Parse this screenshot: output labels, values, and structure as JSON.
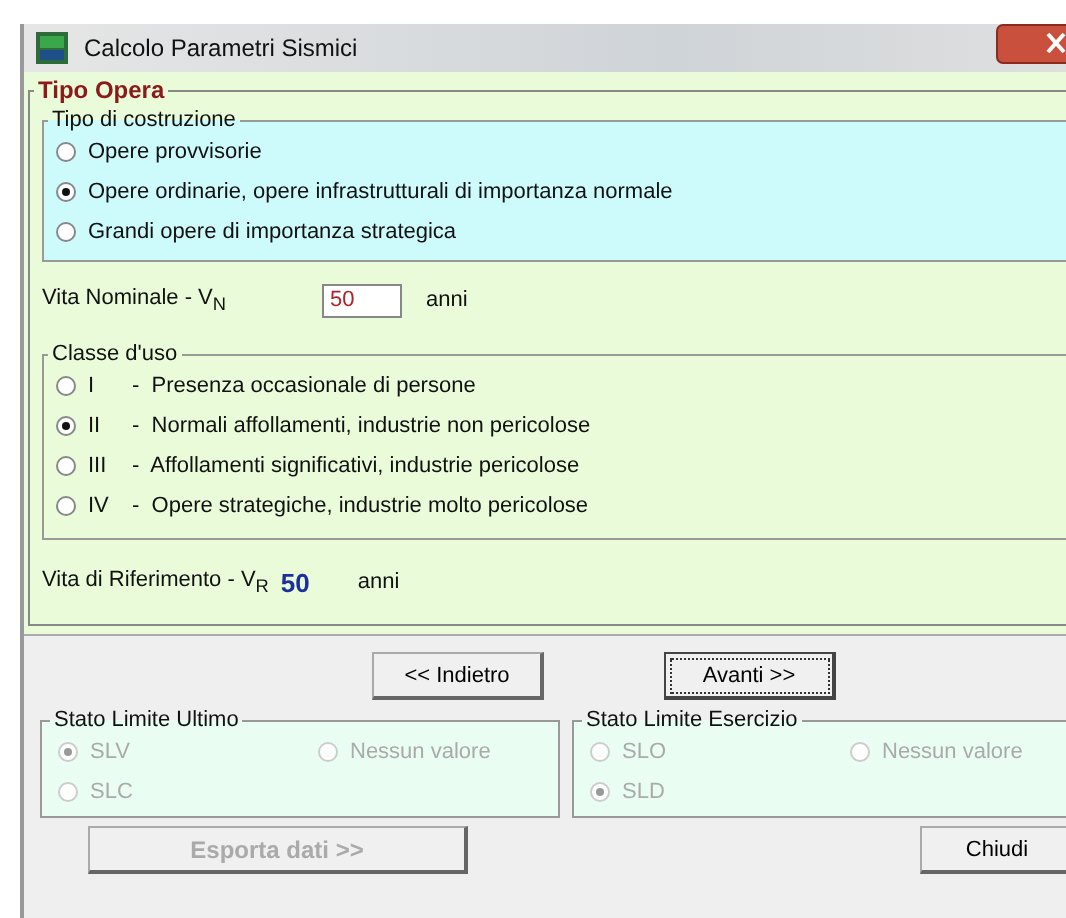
{
  "window": {
    "title": "Calcolo Parametri Sismici"
  },
  "tipo_opera": {
    "title": "Tipo Opera",
    "tipo_costruzione": {
      "title": "Tipo di costruzione",
      "options": [
        {
          "label": "Opere provvisorie",
          "selected": false
        },
        {
          "label": "Opere ordinarie, opere infrastrutturali di importanza normale",
          "selected": true
        },
        {
          "label": "Grandi opere di importanza strategica",
          "selected": false
        }
      ]
    },
    "vita_nominale": {
      "label": "Vita Nominale - V$_{N}$",
      "value": "50",
      "unit": "anni"
    },
    "classe_uso": {
      "title": "Classe d'uso",
      "options": [
        {
          "numeral": "I",
          "label": "-  Presenza occasionale di persone",
          "selected": false
        },
        {
          "numeral": "II",
          "label": "-  Normali affollamenti, industrie non pericolose",
          "selected": true
        },
        {
          "numeral": "III",
          "label": "-  Affollamenti significativi, industrie pericolose",
          "selected": false
        },
        {
          "numeral": "IV",
          "label": "-  Opere strategiche, industrie molto pericolose",
          "selected": false
        }
      ]
    },
    "vita_riferimento": {
      "label": "Vita di Riferimento - V$_{R}$",
      "value": "50",
      "unit": "anni"
    }
  },
  "nav_buttons": [
    {
      "label": "<< Indietro",
      "focused": false
    },
    {
      "label": "Avanti >>",
      "focused": true
    }
  ],
  "limit_groups": [
    {
      "title": "Stato Limite Ultimo",
      "disabled": true,
      "options": [
        {
          "label": "SLV",
          "selected": true
        },
        {
          "label": "Nessun valore",
          "selected": false
        },
        {
          "label": "SLC",
          "selected": false
        }
      ]
    },
    {
      "title": "Stato Limite Esercizio",
      "disabled": true,
      "options": [
        {
          "label": "SLO",
          "selected": false
        },
        {
          "label": "Nessun valore",
          "selected": false
        },
        {
          "label": "SLD",
          "selected": true
        }
      ]
    }
  ],
  "export_button": {
    "label": "Esporta dati    >>",
    "disabled": true
  },
  "close_button": {
    "label": "Chiudi"
  }
}
